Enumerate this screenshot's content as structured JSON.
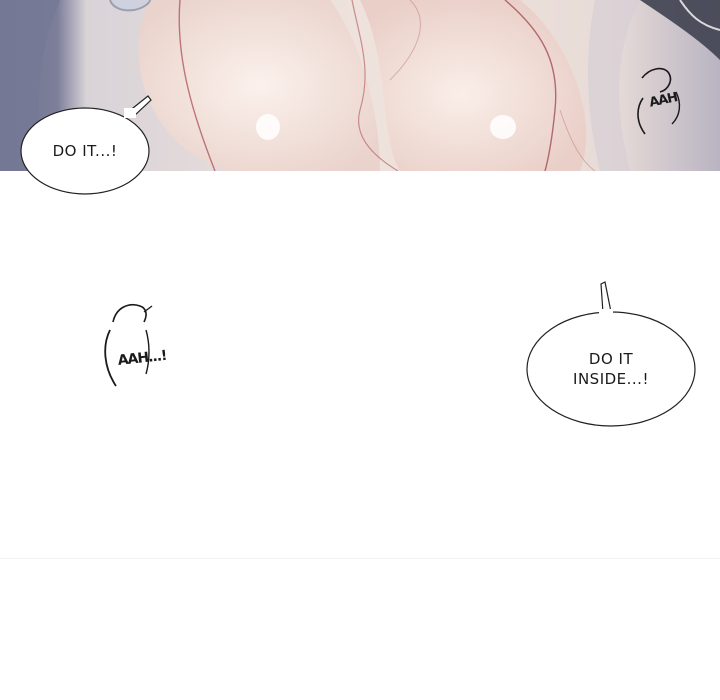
{
  "panel_top": {
    "speech_bubble": {
      "text": "DO IT...!"
    },
    "sound_effect": {
      "text": "AAH"
    }
  },
  "panel_middle": {
    "sound_effect": {
      "text": "AAH...!"
    },
    "speech_bubble": {
      "lines": [
        "DO IT",
        "INSIDE...!"
      ]
    }
  }
}
